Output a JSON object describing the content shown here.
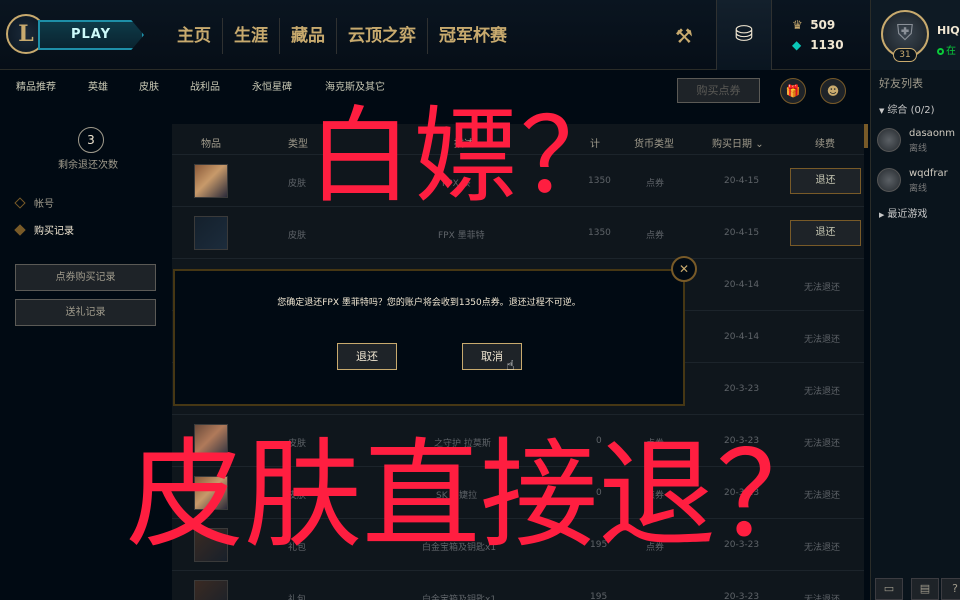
{
  "header": {
    "play_label": "PLAY",
    "nav_tabs": [
      "主页",
      "生涯",
      "藏品",
      "云顶之弈",
      "冠军杯赛"
    ],
    "rp_amount": "509",
    "be_amount": "1130"
  },
  "profile": {
    "name": "HIQ",
    "level": "31",
    "status": "在"
  },
  "friends": {
    "title": "好友列表",
    "group_label": "综合 (0/2)",
    "items": [
      {
        "name": "dasaonm",
        "status": "离线"
      },
      {
        "name": "wqdfrar",
        "status": "离线"
      }
    ],
    "recent_label": "最近游戏"
  },
  "subnav": {
    "tabs": [
      "精品推荐",
      "英雄",
      "皮肤",
      "战利品",
      "永恒星碑",
      "海克斯及其它"
    ],
    "buy_rp_label": "购买点券"
  },
  "sidebar": {
    "refund_count": "3",
    "refund_label": "剩余退还次数",
    "links": [
      "帐号",
      "购买记录"
    ],
    "buttons": [
      "点券购买记录",
      "送礼记录"
    ]
  },
  "table": {
    "headers": [
      "物品",
      "类型",
      "描述",
      "计",
      "货币类型",
      "购买日期",
      "续费"
    ],
    "rows": [
      {
        "type": "皮肤",
        "desc": "FPX 辰",
        "price": "1350",
        "currency": "点券",
        "date": "20-4-15",
        "action": "退还"
      },
      {
        "type": "皮肤",
        "desc": "FPX 墨菲特",
        "price": "1350",
        "currency": "点券",
        "date": "20-4-15",
        "action": "退还"
      },
      {
        "type": "",
        "desc": "",
        "price": "",
        "currency": "",
        "date": "20-4-14",
        "action": "无法退还"
      },
      {
        "type": "",
        "desc": "",
        "price": "",
        "currency": "",
        "date": "20-4-14",
        "action": "无法退还"
      },
      {
        "type": "",
        "desc": "",
        "price": "",
        "currency": "",
        "date": "20-3-23",
        "action": "无法退还"
      },
      {
        "type": "皮肤",
        "desc": "之守护 拉莫斯",
        "price": "0",
        "currency": "点券",
        "date": "20-3-23",
        "action": "无法退还"
      },
      {
        "type": "皮肤",
        "desc": "SK 1 婕拉",
        "price": "0",
        "currency": "点券",
        "date": "20-3-23",
        "action": "无法退还"
      },
      {
        "type": "礼包",
        "desc": "白金宝箱及钥匙x1",
        "price": "195",
        "currency": "点券",
        "date": "20-3-23",
        "action": "无法退还"
      },
      {
        "type": "礼包",
        "desc": "白金宝箱及钥匙x1",
        "price": "195",
        "currency": "",
        "date": "20-3-23",
        "action": "无法退还"
      }
    ]
  },
  "modal": {
    "message": "您确定退还FPX 墨菲特吗？您的账户将会收到1350点券。退还过程不可逆。",
    "confirm_label": "退还",
    "cancel_label": "取消"
  },
  "overlay": {
    "line1": "白嫖？",
    "line2": "皮肤直接退？"
  },
  "colors": {
    "gold": "#c8aa6e",
    "overlay_red": "#ff1e40",
    "background": "#010a13"
  }
}
